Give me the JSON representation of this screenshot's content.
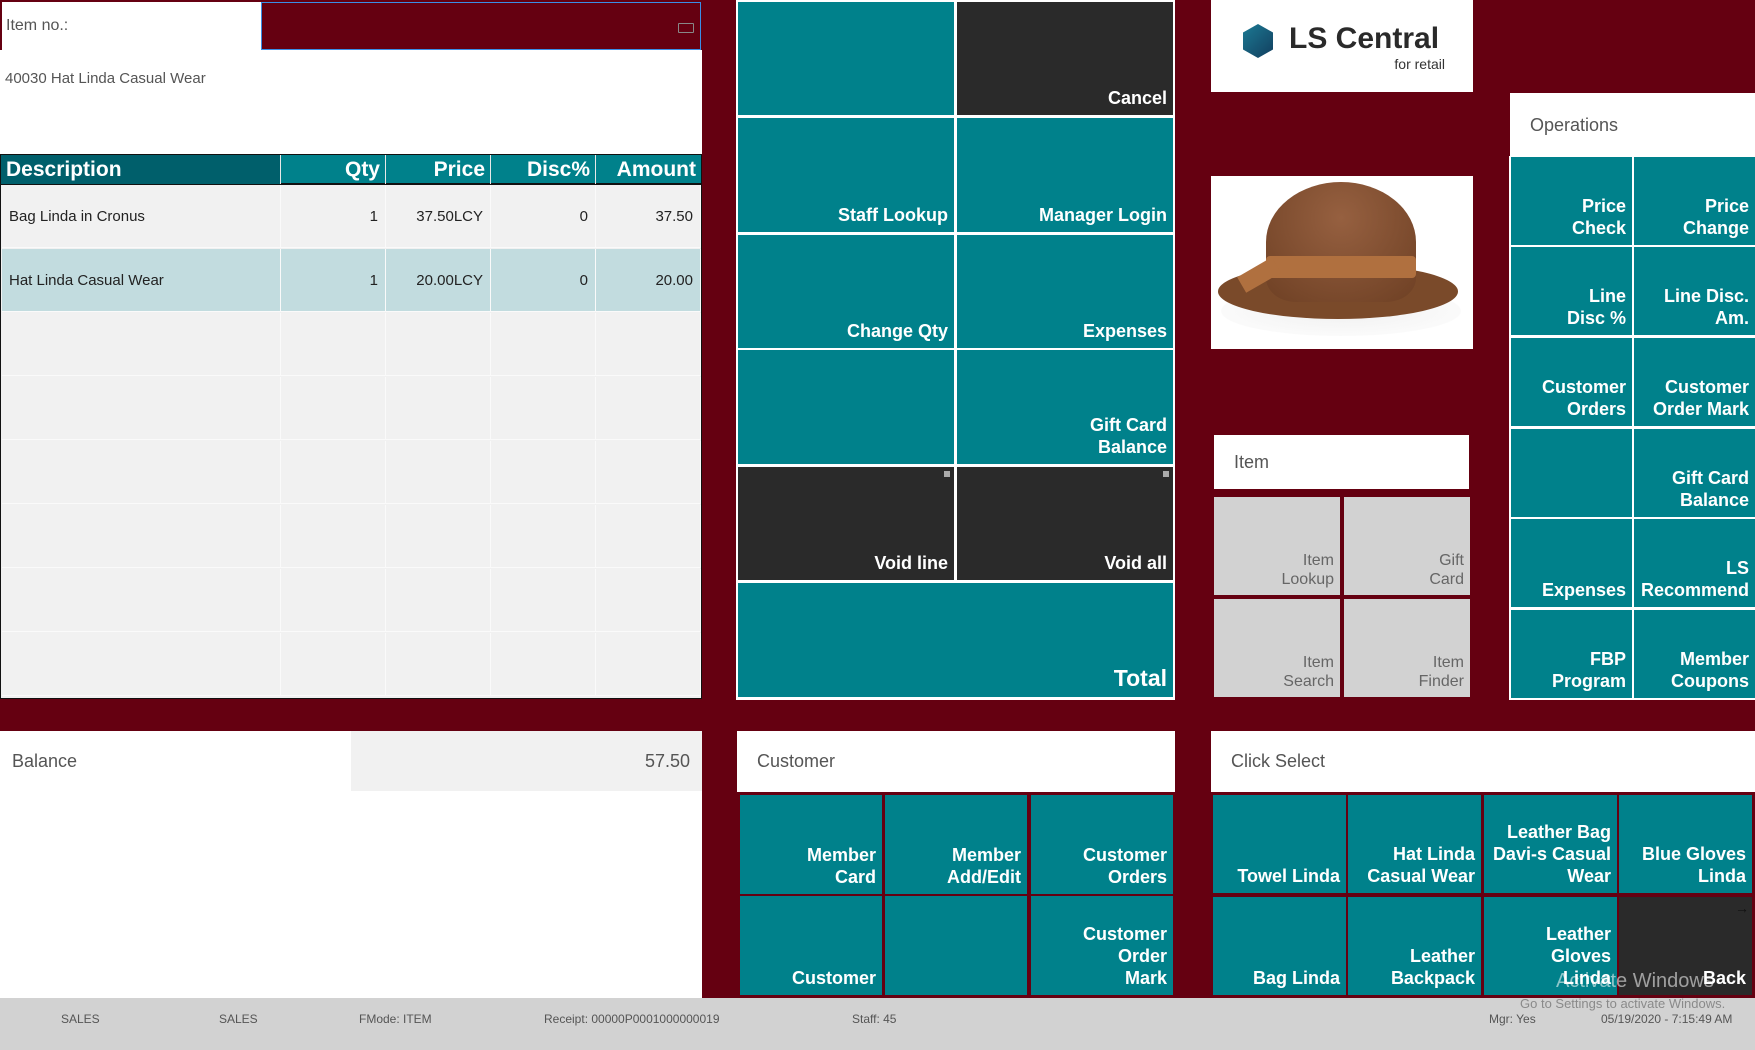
{
  "input": {
    "label": "Item no.:",
    "value": ""
  },
  "info": "40030 Hat Linda Casual Wear",
  "table": {
    "headers": [
      "Description",
      "Qty",
      "Price",
      "Disc%",
      "Amount"
    ],
    "rows": [
      [
        "Bag Linda in Cronus",
        "1",
        "37.50LCY",
        "0",
        "37.50"
      ],
      [
        "Hat Linda Casual Wear",
        "1",
        "20.00LCY",
        "0",
        "20.00"
      ]
    ],
    "empty_rows": 6
  },
  "balance": {
    "label": "Balance",
    "value": "57.50"
  },
  "main_buttons": [
    "",
    "Cancel",
    "Staff Lookup",
    "Manager Login",
    "Change Qty",
    "Expenses",
    "",
    "Gift Card\nBalance",
    "Void line",
    "Void all",
    "Total"
  ],
  "logo": {
    "name": "LS Central",
    "sub": "for retail"
  },
  "item_panel": {
    "title": "Item",
    "buttons": [
      "Item\nLookup",
      "Gift\nCard",
      "Item\nSearch",
      "Item\nFinder"
    ]
  },
  "operations": {
    "title": "Operations",
    "buttons": [
      "Price\nCheck",
      "Price\nChange",
      "Line\nDisc %",
      "Line Disc.\nAm.",
      "Customer\nOrders",
      "Customer\nOrder Mark",
      "",
      "Gift Card\nBalance",
      "Expenses",
      "LS\nRecommend",
      "FBP Program",
      "Member\nCoupons"
    ]
  },
  "customer": {
    "title": "Customer",
    "buttons": [
      "Member\nCard",
      "Member\nAdd/Edit",
      "Customer\nOrders",
      "Customer",
      "",
      "Customer\nOrder\nMark"
    ]
  },
  "click_select": {
    "title": "Click Select",
    "buttons": [
      "Towel Linda",
      "Hat Linda\nCasual Wear",
      "Leather Bag\nDavi-s Casual\nWear",
      "Blue Gloves\nLinda",
      "Bag Linda",
      "Leather\nBackpack",
      "Leather Gloves\nLinda",
      "Back"
    ]
  },
  "status": {
    "s1": "SALES",
    "s2": "SALES",
    "fmode": "FMode: ITEM",
    "receipt": "Receipt: 00000P0001000000019",
    "staff": "Staff: 45",
    "mgr": "Mgr: Yes",
    "datetime": "05/19/2020 - 7:15:49 AM"
  },
  "watermark": {
    "line1": "Activate Windows",
    "line2": "Go to Settings to activate Windows."
  },
  "colors": {
    "maroon": "#650011",
    "teal": "#00818b",
    "dark": "#2a2a2a"
  }
}
